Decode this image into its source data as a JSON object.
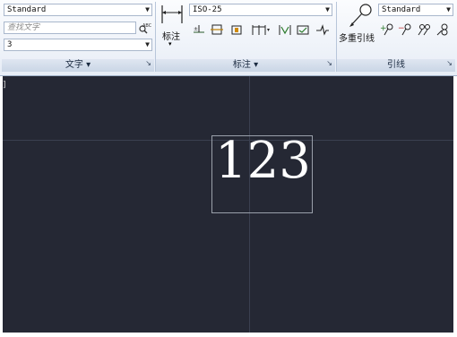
{
  "text_panel": {
    "style_select": "Standard",
    "find_placeholder": "查找文字",
    "height_select": "3",
    "title": "文字"
  },
  "dim_panel": {
    "dim_button_label": "标注",
    "dimstyle_select": "ISO-25",
    "title": "标注"
  },
  "leader_panel": {
    "mleader_button_label": "多重引线",
    "mleader_style_select": "Standard",
    "title": "引线"
  },
  "canvas": {
    "viewport_label": "]",
    "text_object": "123"
  },
  "colors": {
    "canvas_bg": "#252834",
    "ribbon_bg": "#e7edf6",
    "text_color": "#ffffff"
  }
}
